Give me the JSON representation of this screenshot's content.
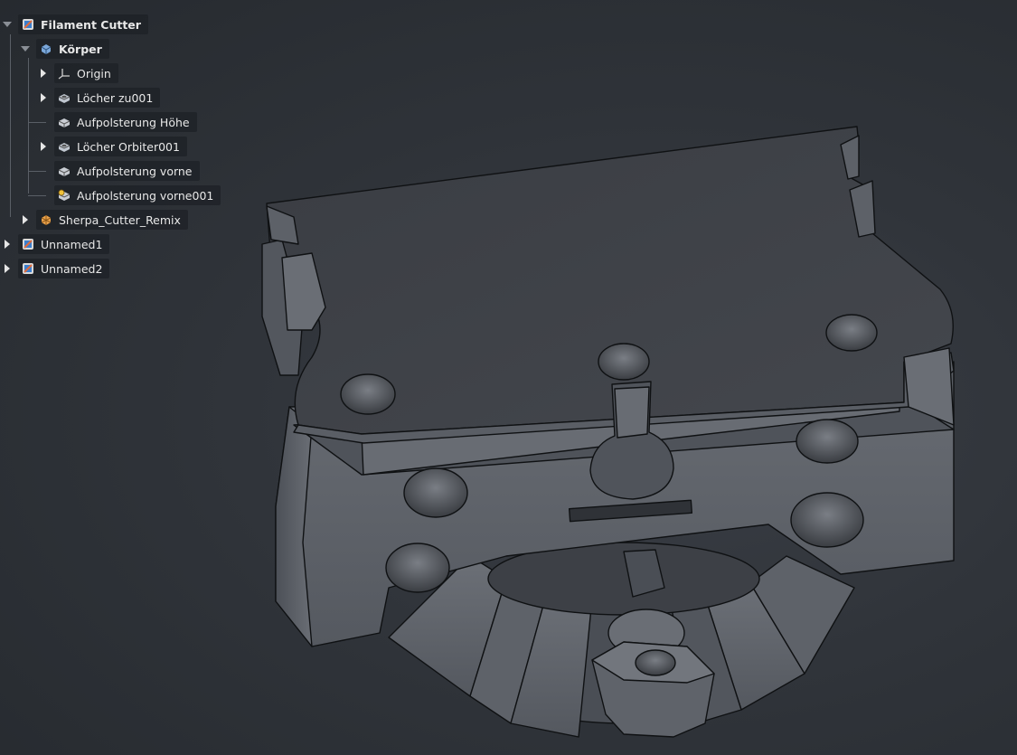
{
  "viewport": {
    "background_color": "#2f3338"
  },
  "tree": {
    "items": [
      {
        "label": "Filament Cutter",
        "icon": "document-icon",
        "expanded": true,
        "bold": true
      },
      {
        "label": "Körper",
        "icon": "body-icon",
        "expanded": true,
        "bold": true
      },
      {
        "label": "Origin",
        "icon": "origin-axes-icon",
        "expanded": false,
        "bold": false
      },
      {
        "label": "Löcher zu001",
        "icon": "pocket-feature-icon",
        "expanded": false,
        "bold": false
      },
      {
        "label": "Aufpolsterung Höhe",
        "icon": "pad-feature-icon",
        "expanded": false,
        "bold": false
      },
      {
        "label": "Löcher Orbiter001",
        "icon": "pocket-feature-icon",
        "expanded": false,
        "bold": false
      },
      {
        "label": "Aufpolsterung vorne",
        "icon": "pad-feature-icon",
        "expanded": false,
        "bold": false
      },
      {
        "label": "Aufpolsterung vorne001",
        "icon": "pad-feature-tip-icon",
        "expanded": false,
        "bold": false
      },
      {
        "label": "Sherpa_Cutter_Remix",
        "icon": "mesh-icon",
        "expanded": false,
        "bold": false
      },
      {
        "label": "Unnamed1",
        "icon": "document-icon",
        "expanded": false,
        "bold": false
      },
      {
        "label": "Unnamed2",
        "icon": "document-icon",
        "expanded": false,
        "bold": false
      }
    ]
  },
  "colors": {
    "model_face_top": "#3e4147",
    "model_face_front": "#5b5f66",
    "model_face_side": "#4a4e55",
    "model_edge": "#0f1113"
  }
}
